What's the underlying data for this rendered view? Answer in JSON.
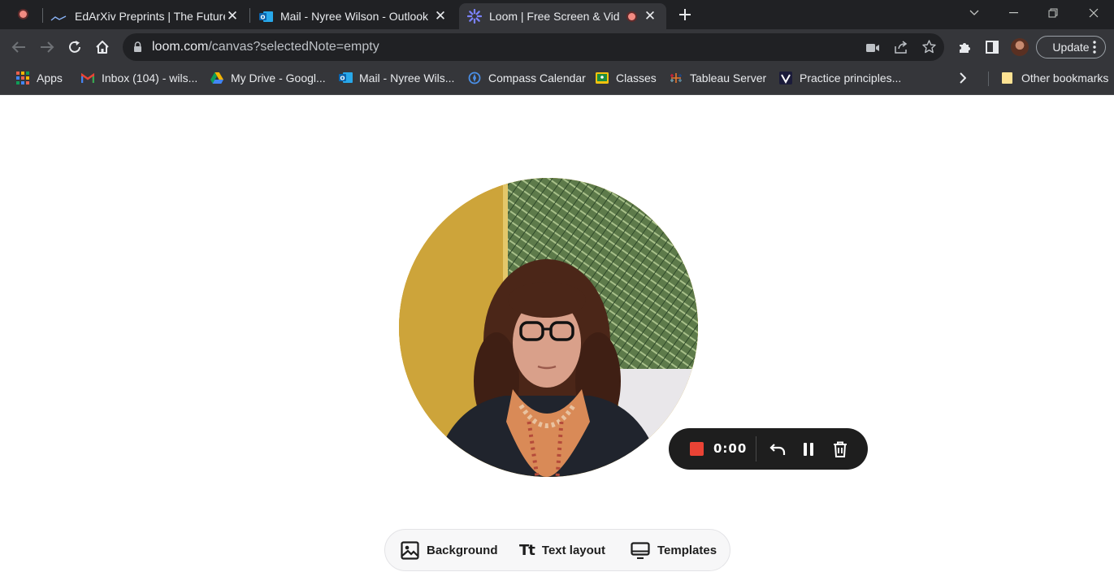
{
  "tabs": [
    {
      "title": "EdArXiv Preprints | The Future of",
      "icon": "edarxiv-icon",
      "active": false
    },
    {
      "title": "Mail - Nyree Wilson - Outlook",
      "icon": "outlook-icon",
      "active": false
    },
    {
      "title": "Loom | Free Screen & Video",
      "icon": "loom-icon",
      "active": true,
      "recording": true
    }
  ],
  "address_bar": {
    "host": "loom.com",
    "path": "/canvas?selectedNote=empty"
  },
  "toolbar": {
    "update_label": "Update"
  },
  "bookmarks": {
    "items": [
      {
        "label": "Apps",
        "icon": "apps-grid-icon"
      },
      {
        "label": "Inbox (104) - wils...",
        "icon": "gmail-icon"
      },
      {
        "label": "My Drive - Googl...",
        "icon": "google-drive-icon"
      },
      {
        "label": "Mail - Nyree Wils...",
        "icon": "outlook-icon"
      },
      {
        "label": "Compass Calendar",
        "icon": "compass-icon"
      },
      {
        "label": "Classes",
        "icon": "classroom-icon"
      },
      {
        "label": "Tableau Server",
        "icon": "tableau-icon"
      },
      {
        "label": "Practice principles...",
        "icon": "practice-icon"
      }
    ],
    "other": "Other bookmarks"
  },
  "recording": {
    "timer": "0:00",
    "stop_color": "#ea4335"
  },
  "canvas_controls": {
    "background": "Background",
    "text_layout": "Text layout",
    "templates": "Templates"
  }
}
